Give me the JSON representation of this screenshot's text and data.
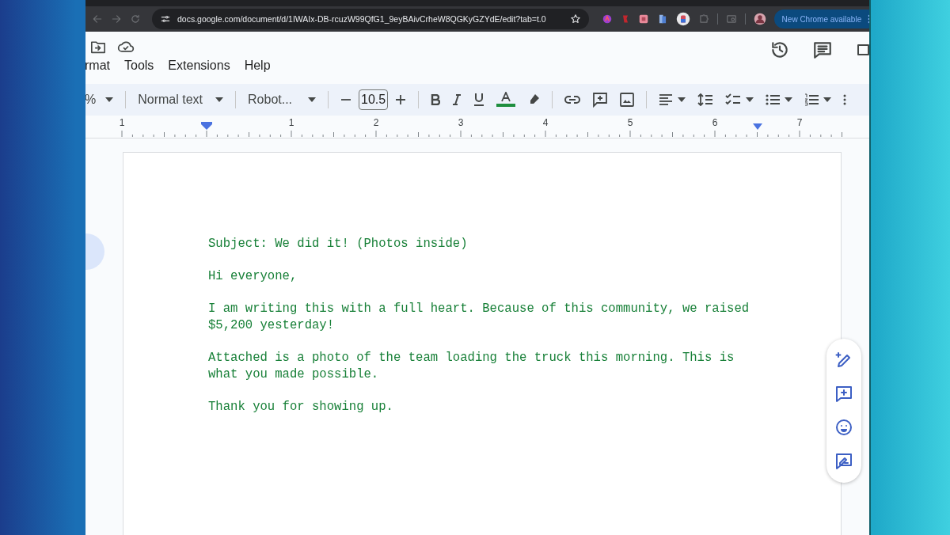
{
  "browser": {
    "url": "docs.google.com/document/d/1IWAIx-DB-rcuzW99QfG1_9eyBAivCrheW8QGKyGZYdE/edit?tab=t.0",
    "update_button": "New Chrome available"
  },
  "menu": [
    "rmat",
    "Tools",
    "Extensions",
    "Help"
  ],
  "toolbar": {
    "zoom": "%",
    "style": "Normal text",
    "font": "Robot...",
    "font_size": "10.5"
  },
  "ruler": {
    "labels": [
      "1",
      "1",
      "2",
      "3",
      "4",
      "5",
      "6",
      "7"
    ]
  },
  "document": {
    "paragraphs": [
      "Subject: We did it! (Photos inside)",
      "Hi everyone,",
      "I am writing this with a full heart. Because of this community, we raised $5,200 yesterday!",
      "Attached is a photo of the team loading the truck this morning. This is what you made possible.",
      "Thank you for showing up."
    ]
  }
}
